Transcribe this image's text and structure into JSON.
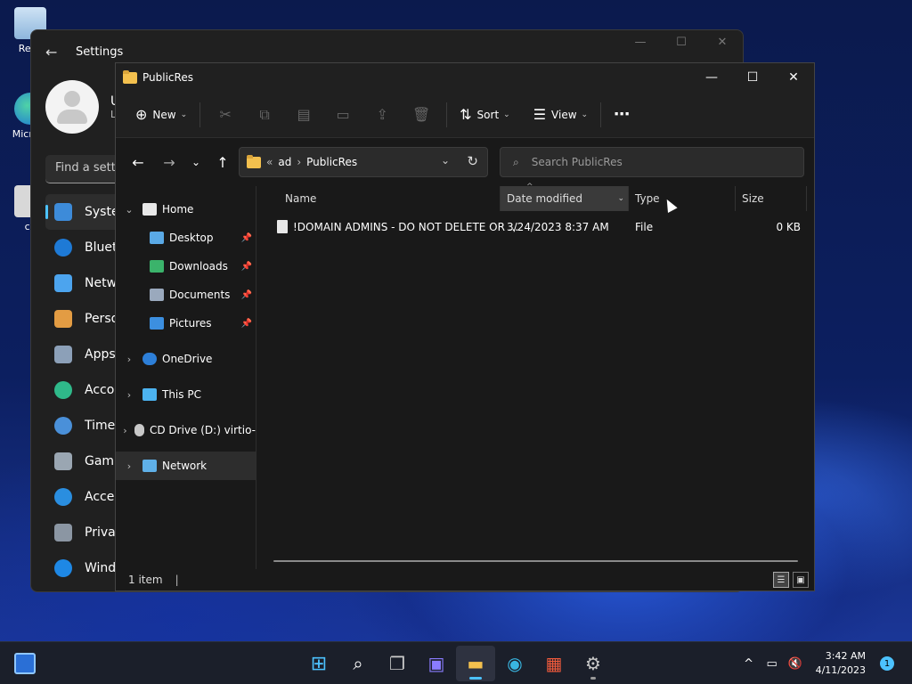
{
  "desktop": {
    "icons": [
      {
        "label": "Recy",
        "icon": "recycle-bin-icon"
      },
      {
        "label": "Micr Ed",
        "icon": "edge-shortcut-icon"
      },
      {
        "label": "ca",
        "icon": "file-shortcut-icon"
      }
    ]
  },
  "settings": {
    "title": "Settings",
    "user_initial": "U",
    "user_sub": "Lo",
    "search_placeholder": "Find a setti",
    "nav": [
      {
        "label": "Syster",
        "icon": "system-icon",
        "active": true
      },
      {
        "label": "Blueto",
        "icon": "bluetooth-icon"
      },
      {
        "label": "Netwo",
        "icon": "network-icon"
      },
      {
        "label": "Perso",
        "icon": "personalization-icon"
      },
      {
        "label": "Apps",
        "icon": "apps-icon"
      },
      {
        "label": "Accou",
        "icon": "accounts-icon"
      },
      {
        "label": "Time",
        "icon": "time-icon"
      },
      {
        "label": "Gamin",
        "icon": "gaming-icon"
      },
      {
        "label": "Acces",
        "icon": "accessibility-icon"
      },
      {
        "label": "Privac",
        "icon": "privacy-icon"
      },
      {
        "label": "Windo",
        "icon": "windows-update-icon"
      }
    ]
  },
  "explorer": {
    "title": "PublicRes",
    "toolbar": {
      "new_label": "New",
      "sort_label": "Sort",
      "view_label": "View"
    },
    "address": {
      "crumbs": [
        "ad",
        "PublicRes"
      ],
      "overflow": "«"
    },
    "search_placeholder": "Search PublicRes",
    "tree": [
      {
        "label": "Home",
        "icon": "home-icon",
        "expanded": true,
        "level": 0
      },
      {
        "label": "Desktop",
        "icon": "desktop-folder-icon",
        "pinned": true,
        "level": 1
      },
      {
        "label": "Downloads",
        "icon": "downloads-icon",
        "pinned": true,
        "level": 1
      },
      {
        "label": "Documents",
        "icon": "documents-icon",
        "pinned": true,
        "level": 1
      },
      {
        "label": "Pictures",
        "icon": "pictures-icon",
        "pinned": true,
        "level": 1
      },
      {
        "label": "OneDrive",
        "icon": "onedrive-icon",
        "level": 0
      },
      {
        "label": "This PC",
        "icon": "this-pc-icon",
        "level": 0
      },
      {
        "label": "CD Drive (D:) virtio-",
        "icon": "cd-drive-icon",
        "level": 0
      },
      {
        "label": "Network",
        "icon": "network-icon",
        "level": 0,
        "selected": true
      }
    ],
    "columns": {
      "name": "Name",
      "date": "Date modified",
      "type": "Type",
      "size": "Size"
    },
    "files": [
      {
        "name": "!DOMAIN ADMINS - DO NOT DELETE OR ...",
        "date": "3/24/2023 8:37 AM",
        "type": "File",
        "size": "0 KB"
      }
    ],
    "status": "1 item"
  },
  "taskbar": {
    "apps": [
      {
        "name": "start-icon",
        "active": false
      },
      {
        "name": "search-icon",
        "active": false
      },
      {
        "name": "task-view-icon",
        "active": false
      },
      {
        "name": "chat-icon",
        "active": false
      },
      {
        "name": "file-explorer-icon",
        "active": true
      },
      {
        "name": "edge-icon",
        "active": false
      },
      {
        "name": "store-icon",
        "active": false
      },
      {
        "name": "settings-icon",
        "running": true
      }
    ],
    "time": "3:42 AM",
    "date": "4/11/2023",
    "notification_count": "1"
  },
  "colors": {
    "accent": "#4cc2ff",
    "folder": "#f3c04e",
    "window_bg": "#191919"
  }
}
